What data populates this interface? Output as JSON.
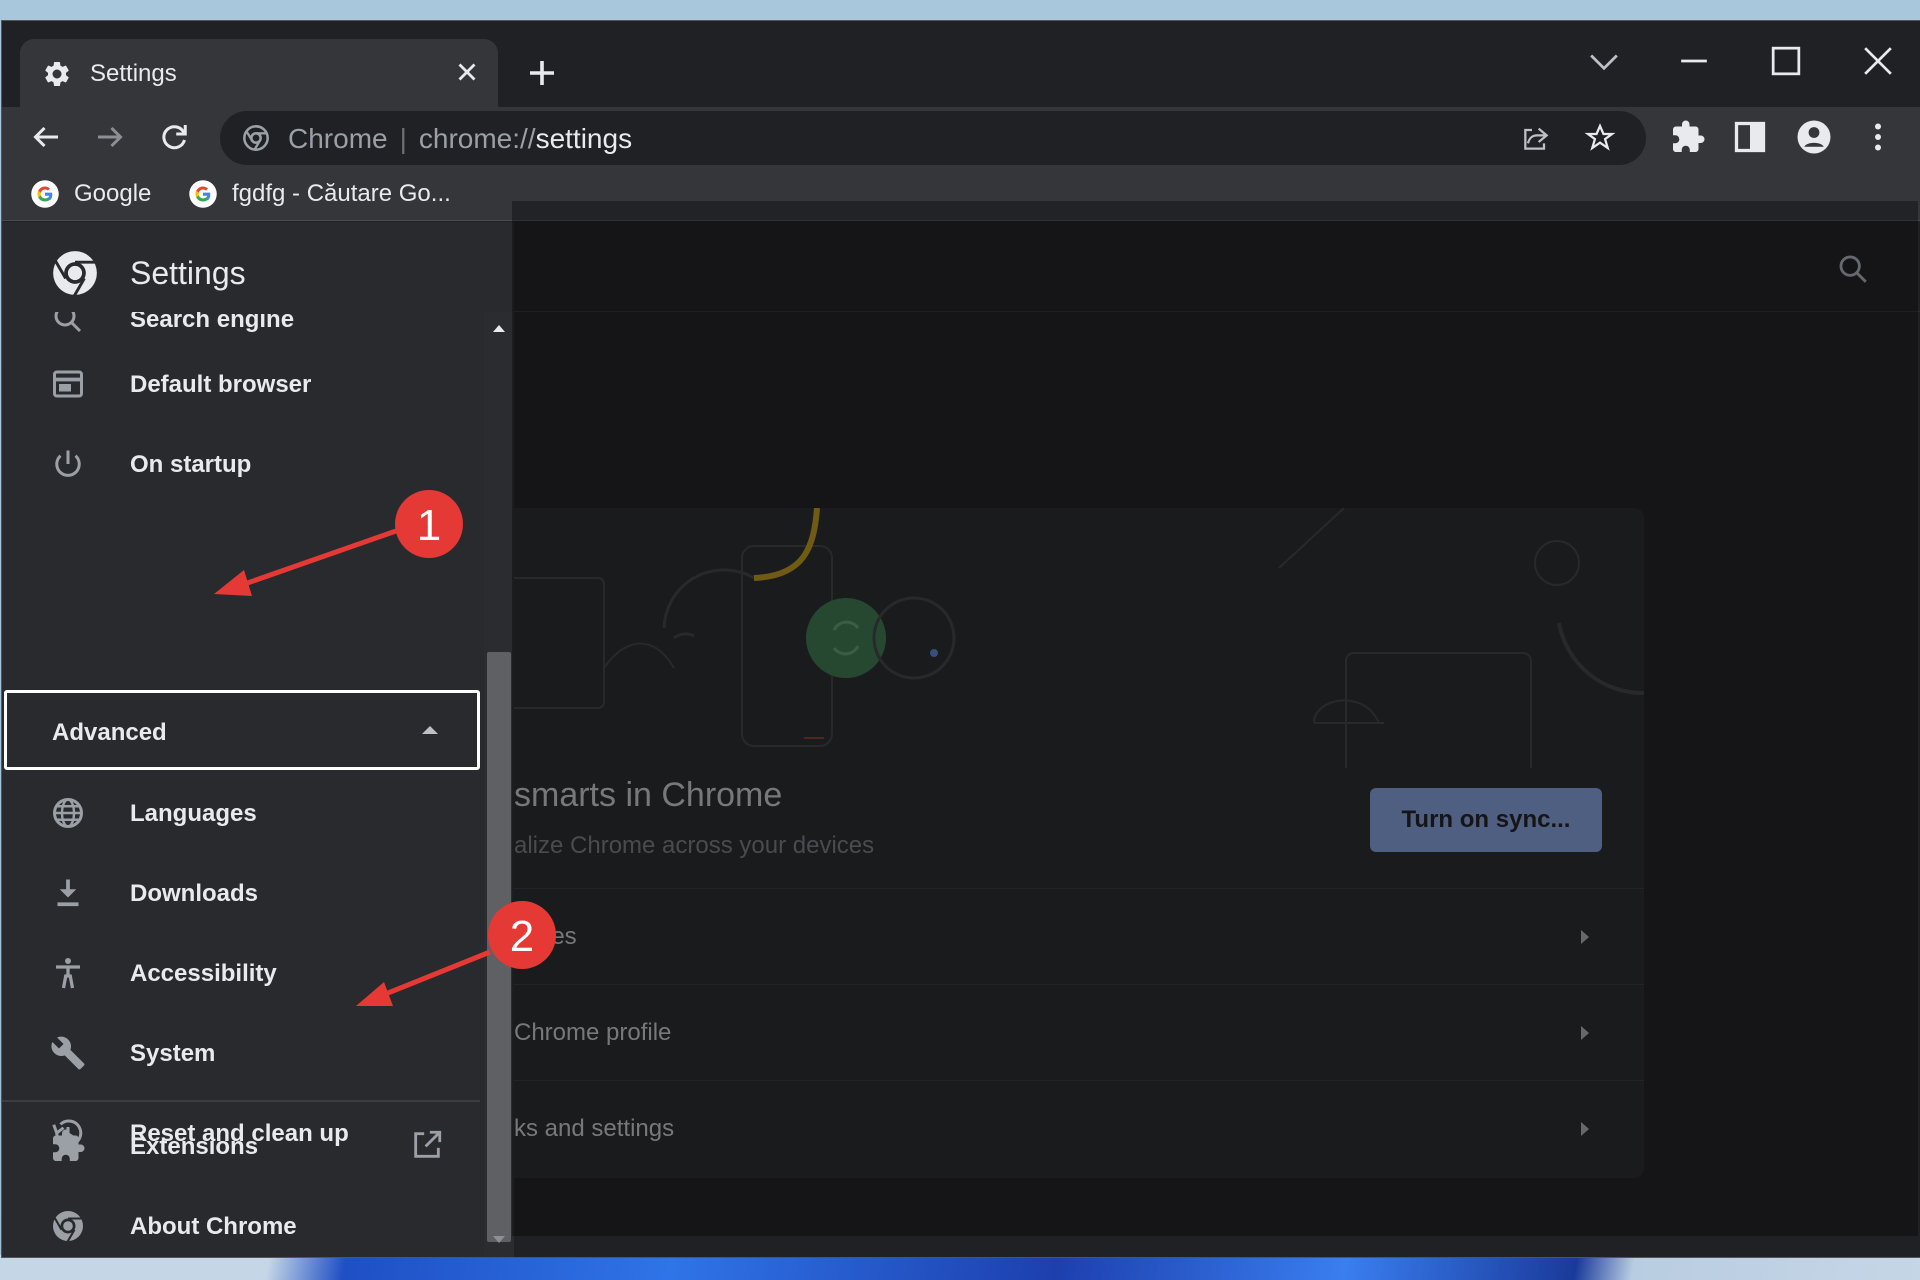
{
  "tab": {
    "title": "Settings"
  },
  "omnibox": {
    "site": "Chrome",
    "scheme": "chrome://",
    "path": "settings"
  },
  "bookmarks": [
    {
      "label": "Google"
    },
    {
      "label": "fgdfg - Căutare Go..."
    }
  ],
  "settings": {
    "title": "Settings",
    "nav": {
      "search_engine": "Search engine",
      "default_browser": "Default browser",
      "on_startup": "On startup",
      "advanced": "Advanced",
      "languages": "Languages",
      "downloads": "Downloads",
      "accessibility": "Accessibility",
      "system": "System",
      "reset": "Reset and clean up",
      "extensions": "Extensions",
      "about": "About Chrome"
    }
  },
  "sync_card": {
    "headline": "smarts in Chrome",
    "subline": "alize Chrome across your devices",
    "button": "Turn on sync...",
    "rows": [
      "rvices",
      "Chrome profile",
      "ks and settings"
    ]
  },
  "annotations": {
    "marker1": "1",
    "marker2": "2",
    "arrow_color": "#e53935"
  },
  "colors": {
    "accent": "#8ab4f8",
    "sync_button": "#7891c6",
    "background": "#202124",
    "sidebar": "#292a2d"
  }
}
